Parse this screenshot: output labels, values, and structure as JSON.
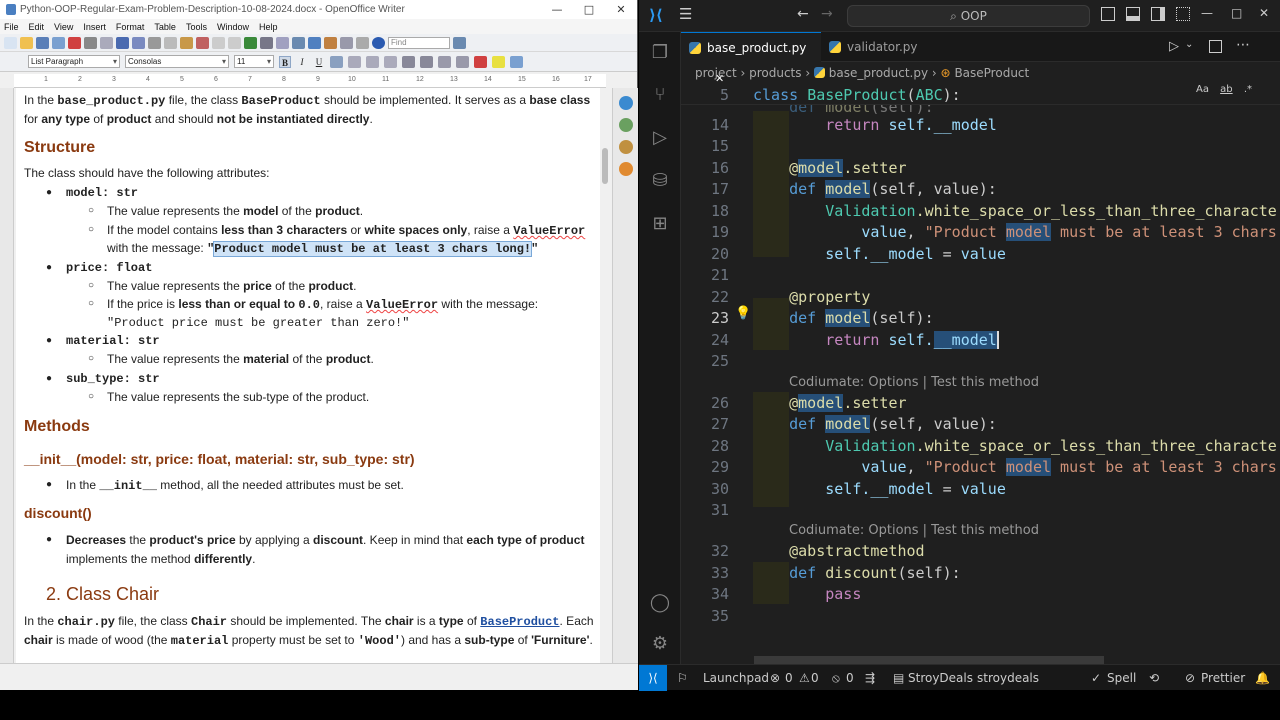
{
  "writer": {
    "title": "Python-OOP-Regular-Exam-Problem-Description-10-08-2024.docx - OpenOffice Writer",
    "window_controls": [
      "—",
      "□",
      "✕"
    ],
    "menu": [
      "File",
      "Edit",
      "View",
      "Insert",
      "Format",
      "Table",
      "Tools",
      "Window",
      "Help"
    ],
    "find_placeholder": "Find",
    "style": "List Paragraph",
    "font": "Consolas",
    "size": "11",
    "ruler": [
      "1",
      "2",
      "3",
      "4",
      "5",
      "6",
      "7",
      "8",
      "9",
      "10",
      "11",
      "12",
      "13",
      "14",
      "15",
      "16",
      "17"
    ],
    "doc": {
      "intro1a": "In the ",
      "intro1b": "base_product.py",
      "intro1c": " file, the class ",
      "intro1d": "BaseProduct",
      "intro1e": " should be implemented. It serves as a ",
      "intro1f": "base class",
      "intro2a": "for ",
      "intro2b": "any type",
      "intro2c": " of ",
      "intro2d": "product",
      "intro2e": " and should ",
      "intro2f": "not be instantiated directly",
      "intro2g": ".",
      "structure": "Structure",
      "attrs_intro": "The class should have the following attributes:",
      "a1": "model: str",
      "a1s1a": "The value represents the ",
      "a1s1b": "model",
      "a1s1c": " of the ",
      "a1s1d": "product",
      "a1s1e": ".",
      "a1s2a": "If the model contains ",
      "a1s2b": "less than 3 characters",
      "a1s2c": " or ",
      "a1s2d": "white spaces only",
      "a1s2e": ", raise a ",
      "a1s2f": "ValueError",
      "a1s3a": "with the message: ",
      "a1s3q1": "\"",
      "a1s3b": "Product model must be at least 3 chars long!",
      "a1s3q2": "\"",
      "a2": "price: float",
      "a2s1a": "The value represents the ",
      "a2s1b": "price",
      "a2s1c": " of the ",
      "a2s1d": "product",
      "a2s1e": ".",
      "a2s2a": "If the price is ",
      "a2s2b": "less than or equal to ",
      "a2s2c": "0.0",
      "a2s2d": ", raise a ",
      "a2s2e": "ValueError",
      "a2s2f": " with the message:",
      "a2s3": "\"Product price must be greater than zero!\"",
      "a3": "material: str",
      "a3s1a": "The value represents the ",
      "a3s1b": "material",
      "a3s1c": " of the ",
      "a3s1d": "product",
      "a3s1e": ".",
      "a4": "sub_type: str",
      "a4s1": "The value represents the sub-type of the product.",
      "methods": "Methods",
      "init_sig": "__init__(model: str, price: float, material: str, sub_type: str)",
      "init_a": "In the ",
      "init_b": "__init__",
      "init_c": " method, all the needed attributes must be set.",
      "discount_h": "discount()",
      "d1a": "Decreases",
      "d1b": " the ",
      "d1c": "product's price",
      "d1d": " by applying a ",
      "d1e": "discount",
      "d1f": ". Keep in mind that ",
      "d1g": "each type of product",
      "d2a": "implements the method ",
      "d2b": "differently",
      "d2c": ".",
      "chair_h": "2. Class Chair",
      "c1a": "In the ",
      "c1b": "chair.py",
      "c1c": " file, the class ",
      "c1d": "Chair",
      "c1e": " should be implemented. The ",
      "c1f": "chair",
      "c1g": " is a ",
      "c1h": "type",
      "c1i": " of ",
      "c1j": "BaseProduct",
      "c1k": ". Each",
      "c2a": "chair",
      "c2b": " is made of wood (the ",
      "c2c": "material",
      "c2d": " property must be set to ",
      "c2e": "'Wood'",
      "c2f": ") and has a ",
      "c2g": "sub-type",
      "c2h": " of ",
      "c2i": "'Furniture'",
      "c2j": "."
    }
  },
  "vscode": {
    "search": "OOP",
    "tabs": [
      {
        "label": "base_product.py"
      },
      {
        "label": "validator.py"
      }
    ],
    "tab_close": "✕",
    "breadcrumb": [
      "project",
      "products",
      "base_product.py",
      "BaseProduct"
    ],
    "find_opts": [
      "Aa",
      "ab",
      ".*"
    ],
    "line_numbers": {
      "l5": "5",
      "l14": "14",
      "l15": "15",
      "l16": "16",
      "l17": "17",
      "l18": "18",
      "l19": "19",
      "l20": "20",
      "l21": "21",
      "l22": "22",
      "l23": "23",
      "l24": "24",
      "l25": "25",
      "l26": "26",
      "l27": "27",
      "l28": "28",
      "l29": "29",
      "l30": "30",
      "l31": "31",
      "l32": "32",
      "l33": "33",
      "l34": "34",
      "l35": "35"
    },
    "codelens": "Codiumate: Options | Test this method",
    "code": {
      "kw_class": "class",
      "sp": " ",
      "cls_name": "BaseProduct",
      "p_open": "(",
      "abc": "ABC",
      "p_close": "):",
      "def": "def",
      "model": "model",
      "self_sig": "(self):",
      "self_val_sig": "(self, value):",
      "ret": "return",
      "self": "self",
      "dunder": ".__model",
      "dunder_model": "__model",
      "at": "@",
      "setter": ".setter",
      "property": "@property",
      "abstract": "@abstractmethod",
      "validation": "Validation",
      "method": ".white_space_or_less_than_three_characte",
      "value": "value",
      "comma": ",",
      "str_a": "\"Product ",
      "str_b": " must be at least 3 chars",
      "assign": " = ",
      "discount": "discount",
      "pass": "pass",
      "dot": "."
    },
    "status": {
      "launchpad": "Launchpad",
      "errors": "0",
      "warnings": "0",
      "ports": "0",
      "deals": "StroyDeals",
      "deals2": "stroydeals",
      "spell": "Spell",
      "prettier": "Prettier"
    },
    "colors": {
      "accent": "#0078d4",
      "editor_bg": "#1f1f1f",
      "heading": "#8a3a10"
    }
  }
}
